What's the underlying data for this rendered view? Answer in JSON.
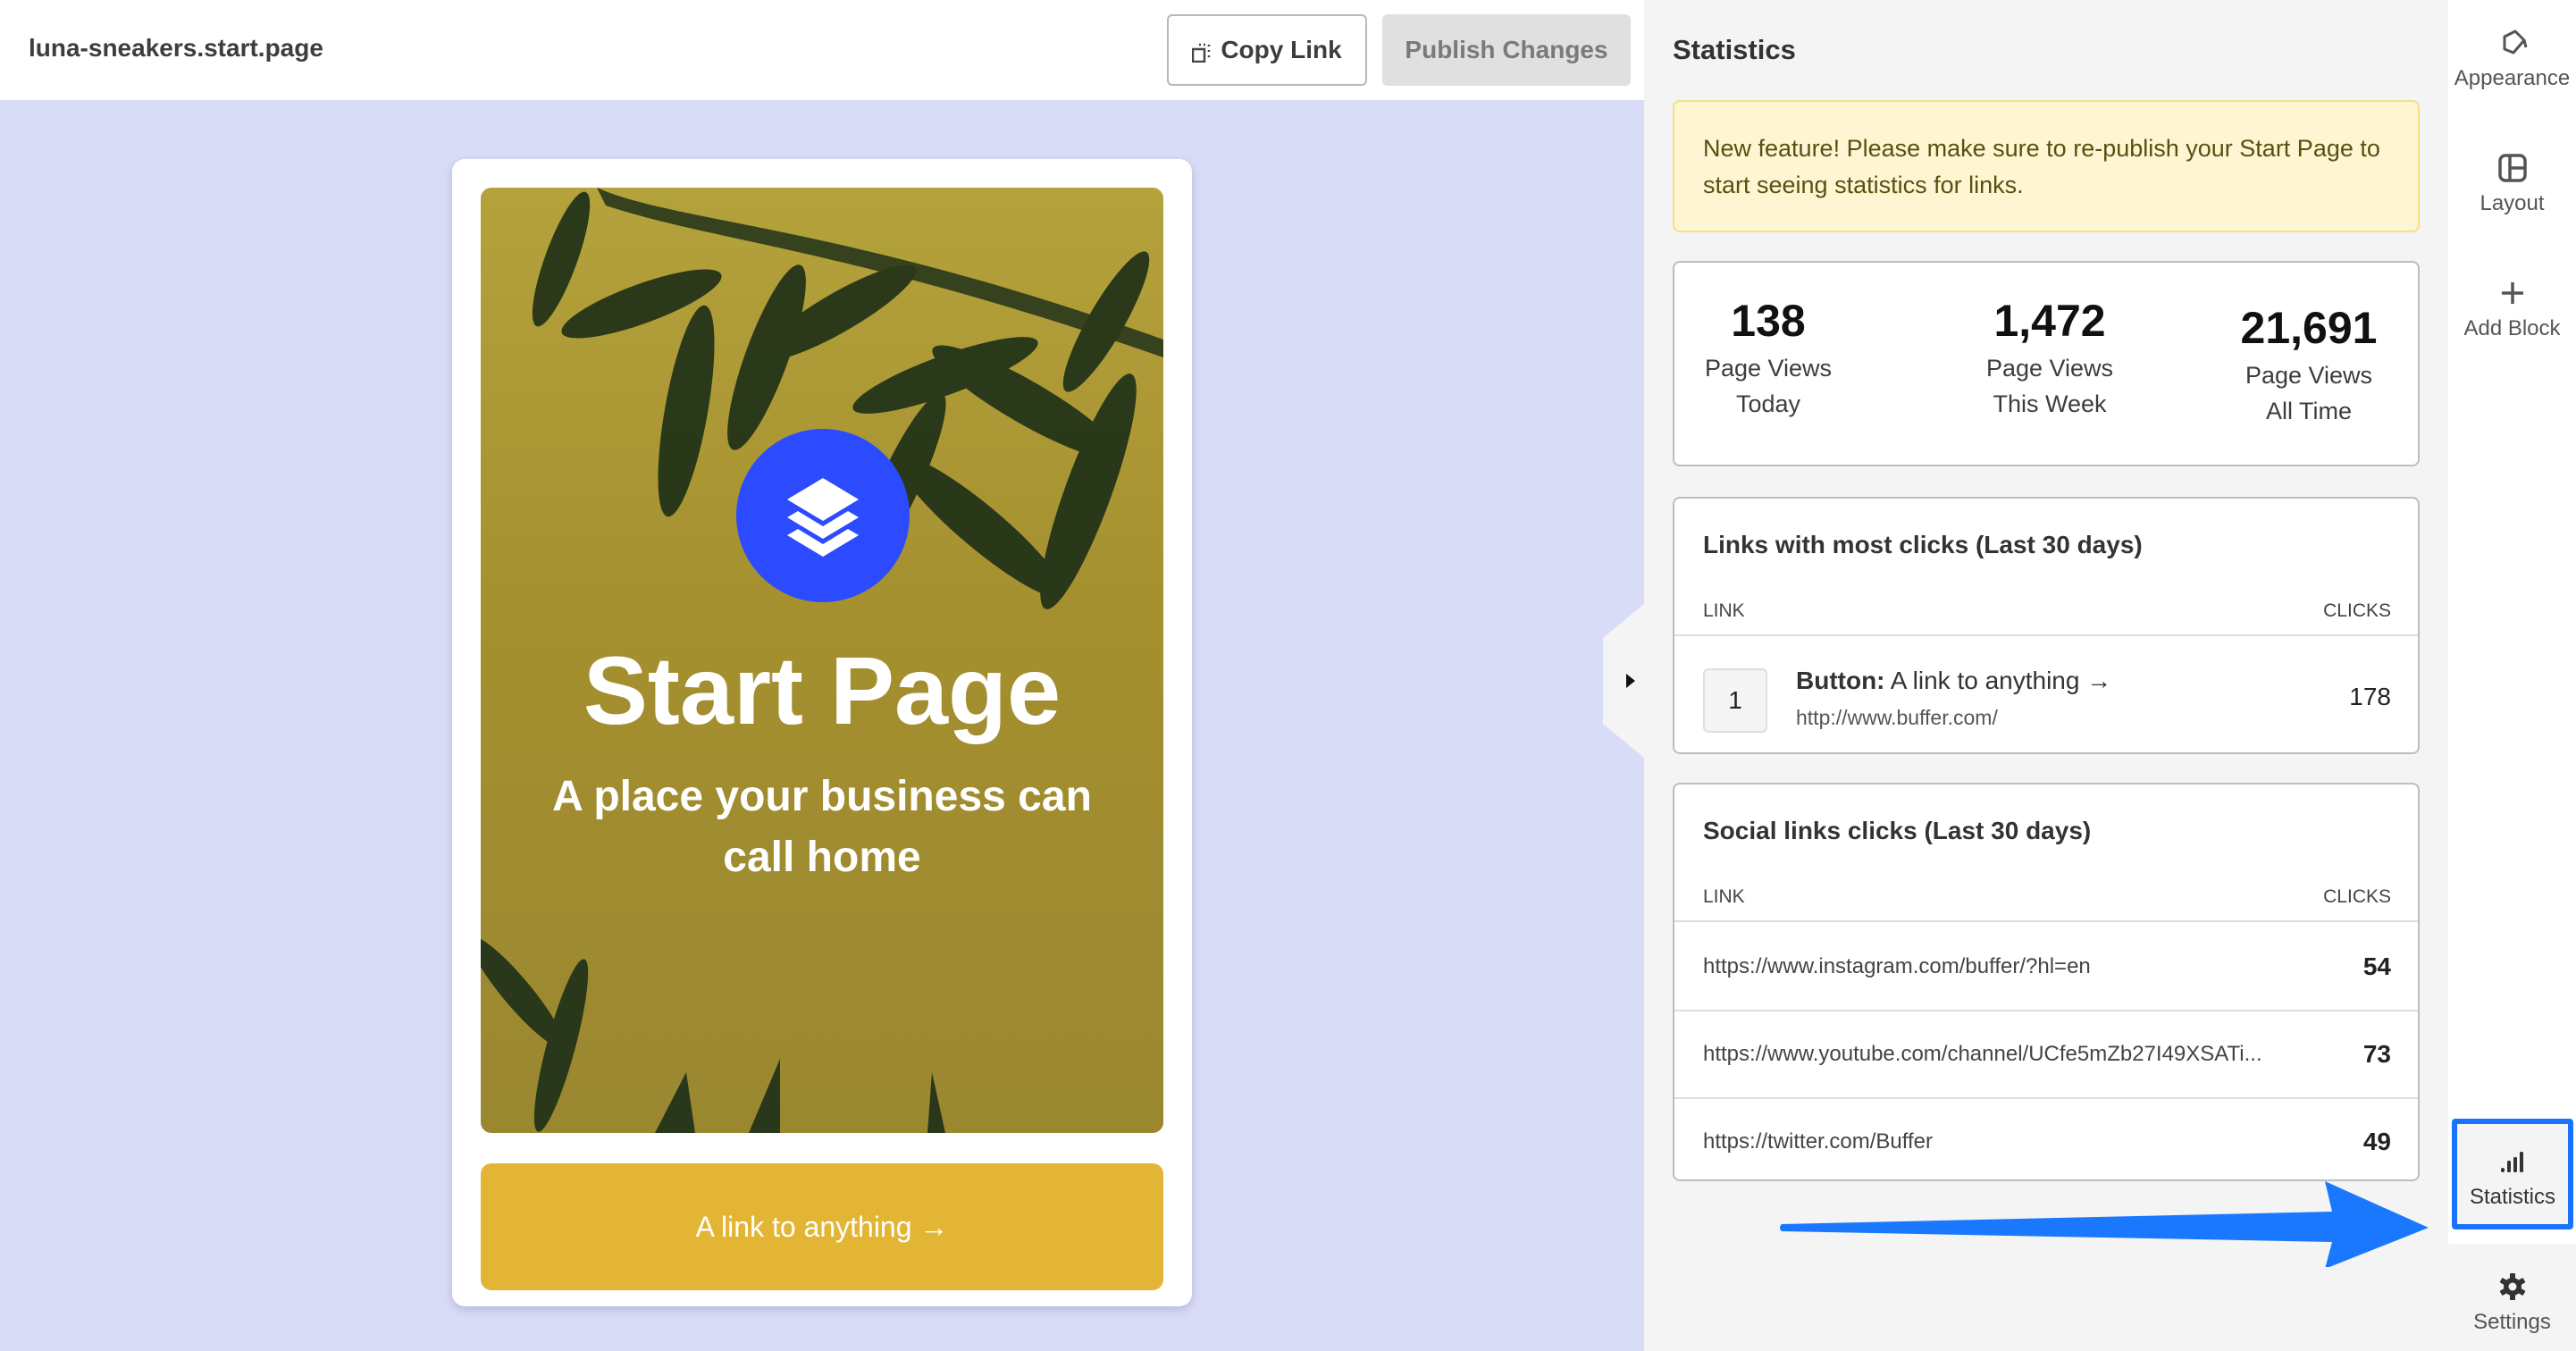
{
  "header": {
    "site_name": "luna-sneakers.start.page",
    "copy_link_label": "Copy Link",
    "publish_label": "Publish Changes"
  },
  "preview": {
    "title": "Start Page",
    "subtitle": "A place your business can call home",
    "link_button": "A link to anything →",
    "logo_icon": "buffer-layers-icon",
    "colors": {
      "canvas_bg": "#d9dcf6",
      "logo_bg": "#2c4bff",
      "button_bg": "#e3b535"
    }
  },
  "statistics": {
    "title": "Statistics",
    "notice": "New feature! Please make sure to re-publish your Start Page to start seeing statistics for links.",
    "page_views": [
      {
        "value": "138",
        "label_line1": "Page Views",
        "label_line2": "Today"
      },
      {
        "value": "1,472",
        "label_line1": "Page Views",
        "label_line2": "This Week"
      },
      {
        "value": "21,691",
        "label_line1": "Page Views",
        "label_line2": "All Time"
      }
    ],
    "top_links": {
      "title": "Links with most clicks (Last 30 days)",
      "col_link": "LINK",
      "col_clicks": "CLICKS",
      "rows": [
        {
          "rank": "1",
          "type": "Button:",
          "label": "A link to anything →",
          "url": "http://www.buffer.com/",
          "clicks": "178"
        }
      ]
    },
    "social_links": {
      "title": "Social links clicks (Last 30 days)",
      "col_link": "LINK",
      "col_clicks": "CLICKS",
      "rows": [
        {
          "url": "https://www.instagram.com/buffer/?hl=en",
          "clicks": "54"
        },
        {
          "url": "https://www.youtube.com/channel/UCfe5mZb27I49XSATi...",
          "clicks": "73"
        },
        {
          "url": "https://twitter.com/Buffer",
          "clicks": "49"
        }
      ]
    }
  },
  "nav": {
    "items": [
      {
        "label": "Appearance",
        "icon": "paint-bucket-icon"
      },
      {
        "label": "Layout",
        "icon": "layout-icon"
      },
      {
        "label": "Add Block",
        "icon": "plus-icon"
      },
      {
        "label": "Statistics",
        "icon": "bar-chart-icon",
        "active": true
      },
      {
        "label": "Settings",
        "icon": "gear-icon"
      }
    ],
    "highlight_color": "#1a73ff"
  }
}
